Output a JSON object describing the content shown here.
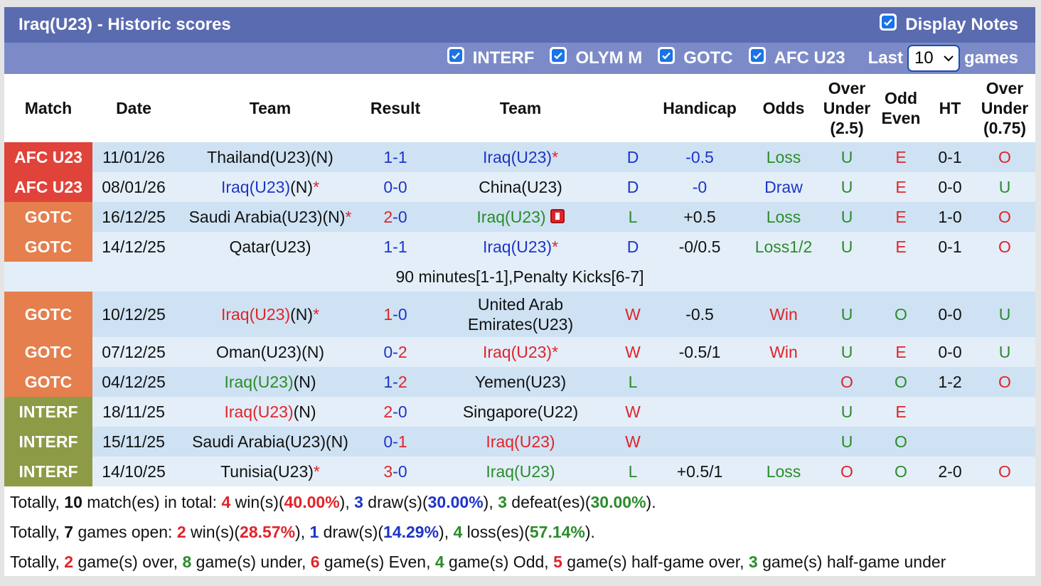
{
  "header": {
    "title": "Iraq(U23) - Historic scores",
    "display_notes_label": "Display Notes"
  },
  "filters": {
    "interf": "INTERF",
    "olym": "OLYM M",
    "gotc": "GOTC",
    "afc": "AFC U23",
    "last_label": "Last",
    "games_value": "10",
    "games_label": "games"
  },
  "columns": {
    "match": "Match",
    "date": "Date",
    "team1": "Team",
    "result": "Result",
    "team2": "Team",
    "handicap": "Handicap",
    "odds": "Odds",
    "ou_a": "Over",
    "ou_b": "Under",
    "ou_c": "(2.5)",
    "oe_a": "Odd",
    "oe_b": "Even",
    "ht": "HT",
    "ou2_a": "Over",
    "ou2_b": "Under",
    "ou2_c": "(0.75)"
  },
  "rows": [
    {
      "comp": "AFC U23",
      "date": "11/01/26",
      "team1": "Thailand(U23)(N)",
      "t1c": "",
      "t1star": "",
      "score_h": "1",
      "score_a": "1",
      "sc_h": "blue",
      "sc_a": "blue",
      "team2": "Iraq(U23)",
      "t2c": "blue",
      "t2star": "*",
      "team2b": "",
      "res": "D",
      "resc": "blue",
      "hcp": "-0.5",
      "hcpc": "blue",
      "odds": "Loss",
      "oddsc": "green",
      "ou": "U",
      "ouc": "green",
      "oe": "E",
      "oec": "red",
      "ht": "0-1",
      "ou2": "O",
      "ou2c": "red"
    },
    {
      "comp": "AFC U23",
      "date": "08/01/26",
      "team1": "Iraq(U23)",
      "t1sfx": "(N)",
      "t1c": "blue",
      "t1star": "*",
      "score_h": "0",
      "score_a": "0",
      "sc_h": "blue",
      "sc_a": "blue",
      "team2": "China(U23)",
      "t2c": "",
      "t2star": "",
      "team2b": "",
      "res": "D",
      "resc": "blue",
      "hcp": "-0",
      "hcpc": "blue",
      "odds": "Draw",
      "oddsc": "blue",
      "ou": "U",
      "ouc": "green",
      "oe": "E",
      "oec": "red",
      "ht": "0-0",
      "ou2": "U",
      "ou2c": "green"
    },
    {
      "comp": "GOTC",
      "date": "16/12/25",
      "team1": "Saudi Arabia(U23)(N)",
      "t1c": "",
      "t1star": "*",
      "score_h": "2",
      "score_a": "0",
      "sc_h": "red",
      "sc_a": "blue",
      "team2": "Iraq(U23)",
      "t2c": "green",
      "t2star": "",
      "team2b": "",
      "res": "L",
      "resc": "green",
      "hcp": "+0.5",
      "hcpc": "",
      "odds": "Loss",
      "oddsc": "green",
      "ou": "U",
      "ouc": "green",
      "oe": "E",
      "oec": "red",
      "ht": "1-0",
      "ou2": "O",
      "ou2c": "red"
    },
    {
      "comp": "GOTC",
      "date": "14/12/25",
      "team1": "Qatar(U23)",
      "t1c": "",
      "t1star": "",
      "score_h": "1",
      "score_a": "1",
      "sc_h": "blue",
      "sc_a": "blue",
      "team2": "Iraq(U23)",
      "t2c": "blue",
      "t2star": "*",
      "team2b": "",
      "res": "D",
      "resc": "blue",
      "hcp": "-0/0.5",
      "hcpc": "",
      "odds": "Loss1/2",
      "oddsc": "green",
      "ou": "U",
      "ouc": "green",
      "oe": "E",
      "oec": "red",
      "ht": "0-1",
      "ou2": "O",
      "ou2c": "red"
    },
    {
      "comp": "GOTC",
      "date": "10/12/25",
      "team1": "Iraq(U23)",
      "t1sfx": "(N)",
      "t1c": "red",
      "t1star": "*",
      "score_h": "1",
      "score_a": "0",
      "sc_h": "red",
      "sc_a": "blue",
      "team2": "United Arab",
      "t2c": "",
      "t2star": "",
      "team2b": "Emirates(U23)",
      "res": "W",
      "resc": "red",
      "hcp": "-0.5",
      "hcpc": "",
      "odds": "Win",
      "oddsc": "red",
      "ou": "U",
      "ouc": "green",
      "oe": "O",
      "oec": "green",
      "ht": "0-0",
      "ou2": "U",
      "ou2c": "green"
    },
    {
      "comp": "GOTC",
      "date": "07/12/25",
      "team1": "Oman(U23)(N)",
      "t1c": "",
      "t1star": "",
      "score_h": "0",
      "score_a": "2",
      "sc_h": "blue",
      "sc_a": "red",
      "team2": "Iraq(U23)",
      "t2c": "red",
      "t2star": "*",
      "team2b": "",
      "res": "W",
      "resc": "red",
      "hcp": "-0.5/1",
      "hcpc": "",
      "odds": "Win",
      "oddsc": "red",
      "ou": "U",
      "ouc": "green",
      "oe": "E",
      "oec": "red",
      "ht": "0-0",
      "ou2": "U",
      "ou2c": "green"
    },
    {
      "comp": "GOTC",
      "date": "04/12/25",
      "team1": "Iraq(U23)",
      "t1sfx": "(N)",
      "t1c": "green",
      "t1star": "",
      "score_h": "1",
      "score_a": "2",
      "sc_h": "blue",
      "sc_a": "red",
      "team2": "Yemen(U23)",
      "t2c": "",
      "t2star": "",
      "team2b": "",
      "res": "L",
      "resc": "green",
      "hcp": "",
      "hcpc": "",
      "odds": "",
      "oddsc": "",
      "ou": "O",
      "ouc": "red",
      "oe": "O",
      "oec": "green",
      "ht": "1-2",
      "ou2": "O",
      "ou2c": "red"
    },
    {
      "comp": "INTERF",
      "date": "18/11/25",
      "team1": "Iraq(U23)",
      "t1sfx": "(N)",
      "t1c": "red",
      "t1star": "",
      "score_h": "2",
      "score_a": "0",
      "sc_h": "red",
      "sc_a": "blue",
      "team2": "Singapore(U22)",
      "t2c": "",
      "t2star": "",
      "team2b": "",
      "res": "W",
      "resc": "red",
      "hcp": "",
      "hcpc": "",
      "odds": "",
      "oddsc": "",
      "ou": "U",
      "ouc": "green",
      "oe": "E",
      "oec": "red",
      "ht": "",
      "ou2": "",
      "ou2c": ""
    },
    {
      "comp": "INTERF",
      "date": "15/11/25",
      "team1": "Saudi Arabia(U23)(N)",
      "t1c": "",
      "t1star": "",
      "score_h": "0",
      "score_a": "1",
      "sc_h": "blue",
      "sc_a": "red",
      "team2": "Iraq(U23)",
      "t2c": "red",
      "t2star": "",
      "team2b": "",
      "res": "W",
      "resc": "red",
      "hcp": "",
      "hcpc": "",
      "odds": "",
      "oddsc": "",
      "ou": "U",
      "ouc": "green",
      "oe": "O",
      "oec": "green",
      "ht": "",
      "ou2": "",
      "ou2c": ""
    },
    {
      "comp": "INTERF",
      "date": "14/10/25",
      "team1": "Tunisia(U23)",
      "t1c": "",
      "t1star": "*",
      "score_h": "3",
      "score_a": "0",
      "sc_h": "red",
      "sc_a": "blue",
      "team2": "Iraq(U23)",
      "t2c": "green",
      "t2star": "",
      "team2b": "",
      "res": "L",
      "resc": "green",
      "hcp": "+0.5/1",
      "hcpc": "",
      "odds": "Loss",
      "oddsc": "green",
      "ou": "O",
      "ouc": "red",
      "oe": "O",
      "oec": "green",
      "ht": "2-0",
      "ou2": "O",
      "ou2c": "red"
    }
  ],
  "note_row": "90 minutes[1-1],Penalty Kicks[6-7]",
  "totals": {
    "l1": {
      "a": "Totally, ",
      "n": "10",
      "b": " match(es) in total: ",
      "w": "4",
      "c": " win(s)(",
      "wp": "40.00%",
      "d": "), ",
      "dr": "3",
      "e": " draw(s)(",
      "drp": "30.00%",
      "f": "), ",
      "l": "3",
      "g": " defeat(es)(",
      "lp": "30.00%",
      "h": ")."
    },
    "l2": {
      "a": "Totally, ",
      "n": "7",
      "b": " games open: ",
      "w": "2",
      "c": " win(s)(",
      "wp": "28.57%",
      "d": "), ",
      "dr": "1",
      "e": " draw(s)(",
      "drp": "14.29%",
      "f": "), ",
      "l": "4",
      "g": " loss(es)(",
      "lp": "57.14%",
      "h": ")."
    },
    "l3": {
      "a": "Totally, ",
      "o": "2",
      "b": " game(s) over, ",
      "u": "8",
      "c": " game(s) under, ",
      "ev": "6",
      "d": " game(s) Even, ",
      "od": "4",
      "e": " game(s) Odd, ",
      "ho": "5",
      "f": " game(s) half-game over, ",
      "hu": "3",
      "g": " game(s) half-game under"
    }
  }
}
